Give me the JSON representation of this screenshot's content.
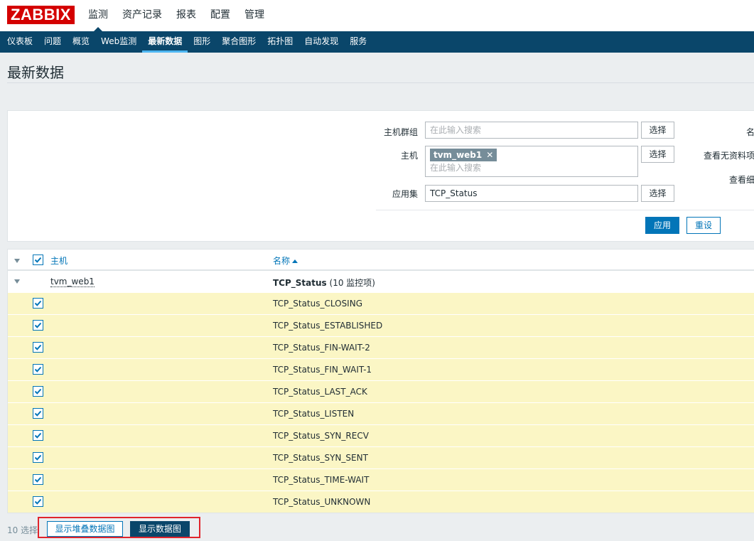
{
  "logo": "ZABBIX",
  "main_nav": [
    "监测",
    "资产记录",
    "报表",
    "配置",
    "管理"
  ],
  "sub_nav": [
    "仪表板",
    "问题",
    "概览",
    "Web监测",
    "最新数据",
    "图形",
    "聚合图形",
    "拓扑图",
    "自动发现",
    "服务"
  ],
  "page_title": "最新数据",
  "filter": {
    "host_group_label": "主机群组",
    "host_group_placeholder": "在此输入搜索",
    "host_label": "主机",
    "host_chip": "tvm_web1",
    "host_placeholder": "在此输入搜索",
    "app_label": "应用集",
    "app_value": "TCP_Status",
    "select_label": "选择",
    "right_name_label": "名",
    "right_nodata_label": "查看无资料项",
    "right_detail_label": "查看细",
    "apply_label": "应用",
    "reset_label": "重设"
  },
  "table": {
    "col_host": "主机",
    "col_name": "名称",
    "host_row": {
      "host": "tvm_web1",
      "app": "TCP_Status",
      "app_count": "(10 监控项)"
    },
    "items": [
      "TCP_Status_CLOSING",
      "TCP_Status_ESTABLISHED",
      "TCP_Status_FIN-WAIT-2",
      "TCP_Status_FIN_WAIT-1",
      "TCP_Status_LAST_ACK",
      "TCP_Status_LISTEN",
      "TCP_Status_SYN_RECV",
      "TCP_Status_SYN_SENT",
      "TCP_Status_TIME-WAIT",
      "TCP_Status_UNKNOWN"
    ]
  },
  "footer": {
    "selected_count": "10 选择",
    "stacked_graph_label": "显示堆叠数据图",
    "graph_label": "显示数据图"
  },
  "colors": {
    "brand_red": "#d40000",
    "nav_blue": "#0a466a",
    "link_blue": "#0275b8",
    "row_yellow": "#fbf6c5",
    "highlight_red": "#e0242c"
  }
}
